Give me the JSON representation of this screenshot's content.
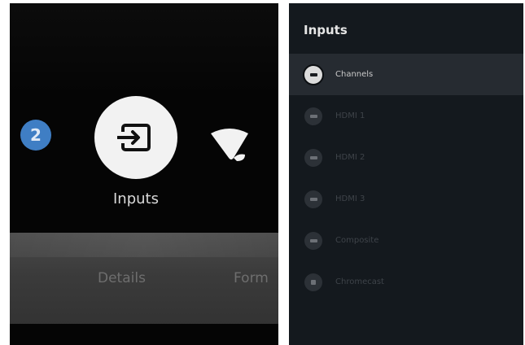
{
  "left": {
    "badge_number": "2",
    "tile_label": "Inputs",
    "band_items": [
      "Details",
      "Form"
    ]
  },
  "right": {
    "title": "Inputs",
    "items": [
      {
        "label": "Channels",
        "selected": true,
        "icon": "tv-icon"
      },
      {
        "label": "HDMI 1",
        "selected": false,
        "icon": "hdmi-icon"
      },
      {
        "label": "HDMI 2",
        "selected": false,
        "icon": "hdmi-icon"
      },
      {
        "label": "HDMI 3",
        "selected": false,
        "icon": "hdmi-icon"
      },
      {
        "label": "Composite",
        "selected": false,
        "icon": "composite-icon"
      },
      {
        "label": "Chromecast",
        "selected": false,
        "icon": "cast-icon"
      }
    ]
  },
  "colors": {
    "badge": "#3f7ec4",
    "tile": "#f2f2f2",
    "right_bg": "#14191e",
    "selected_row": "#262b31"
  }
}
